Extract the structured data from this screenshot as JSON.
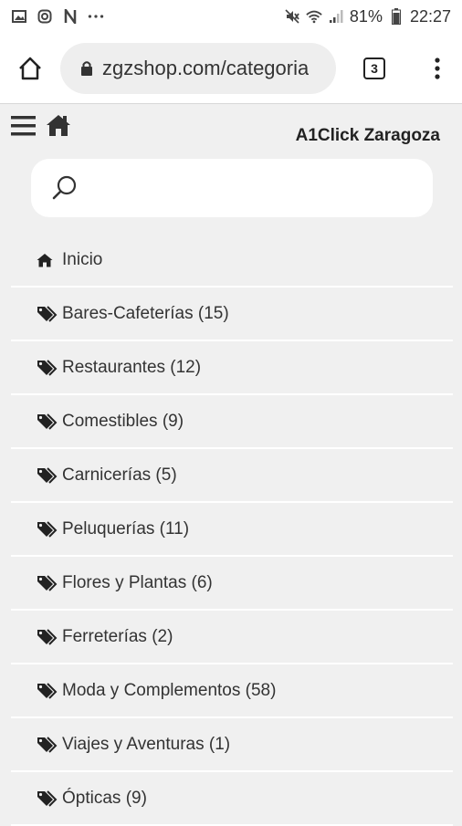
{
  "status_bar": {
    "left_icons": [
      "image-icon",
      "instagram-icon",
      "n-app-icon",
      "more-dots-icon"
    ],
    "right_icons": [
      "mute-icon",
      "wifi-icon",
      "signal-icon"
    ],
    "battery": "81%",
    "time": "22:27"
  },
  "browser": {
    "url": "zgzshop.com/categoria",
    "tab_count": "3"
  },
  "site": {
    "brand": "A1Click Zaragoza",
    "search_placeholder": ""
  },
  "menu": [
    {
      "icon": "home-icon",
      "label": "Inicio"
    },
    {
      "icon": "tags-icon",
      "label": "Bares-Cafeterías (15)"
    },
    {
      "icon": "tags-icon",
      "label": "Restaurantes (12)"
    },
    {
      "icon": "tags-icon",
      "label": "Comestibles (9)"
    },
    {
      "icon": "tags-icon",
      "label": "Carnicerías (5)"
    },
    {
      "icon": "tags-icon",
      "label": "Peluquerías (11)"
    },
    {
      "icon": "tags-icon",
      "label": "Flores y Plantas (6)"
    },
    {
      "icon": "tags-icon",
      "label": "Ferreterías (2)"
    },
    {
      "icon": "tags-icon",
      "label": "Moda y Complementos (58)"
    },
    {
      "icon": "tags-icon",
      "label": "Viajes y Aventuras (1)"
    },
    {
      "icon": "tags-icon",
      "label": "Ópticas (9)"
    }
  ]
}
